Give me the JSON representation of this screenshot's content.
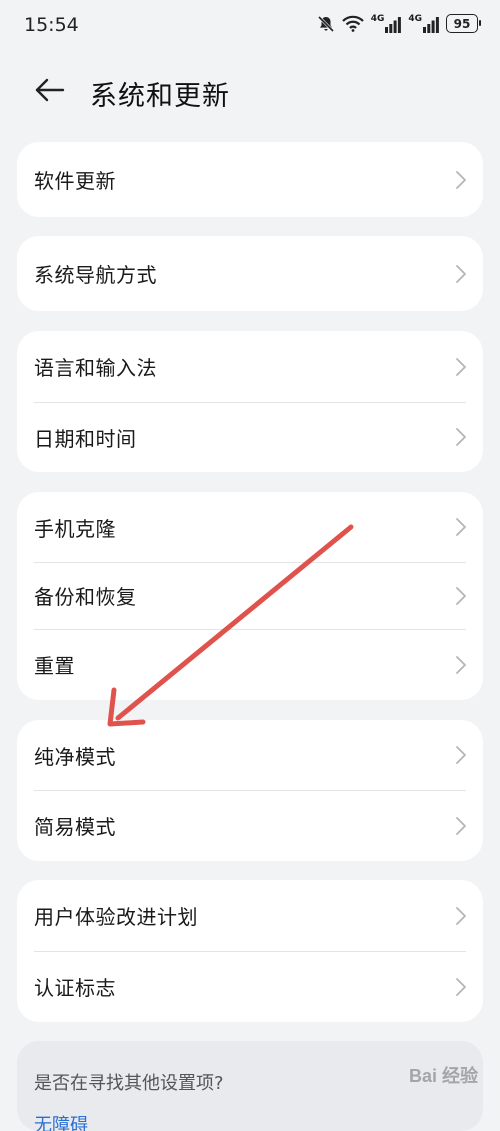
{
  "status_bar": {
    "time": "15:54",
    "battery": "95",
    "network_1": "4G",
    "network_2": "4G"
  },
  "header": {
    "title": "系统和更新",
    "back_icon": "arrow-left-icon"
  },
  "groups": [
    {
      "items": [
        {
          "label": "软件更新"
        }
      ]
    },
    {
      "items": [
        {
          "label": "系统导航方式"
        }
      ]
    },
    {
      "items": [
        {
          "label": "语言和输入法"
        },
        {
          "label": "日期和时间"
        }
      ]
    },
    {
      "items": [
        {
          "label": "手机克隆"
        },
        {
          "label": "备份和恢复"
        },
        {
          "label": "重置"
        }
      ]
    },
    {
      "items": [
        {
          "label": "纯净模式"
        },
        {
          "label": "简易模式"
        }
      ]
    },
    {
      "items": [
        {
          "label": "用户体验改进计划"
        },
        {
          "label": "认证标志"
        }
      ]
    }
  ],
  "hint": {
    "title": "是否在寻找其他设置项?",
    "link": "无障碍"
  },
  "annotation": {
    "arrow_color": "#e0524c",
    "icon": "annotation-arrow"
  },
  "watermark": {
    "text": "Bai 经验"
  },
  "colors": {
    "background": "#f1f3f5",
    "card": "#ffffff",
    "link": "#2a6fd4"
  }
}
